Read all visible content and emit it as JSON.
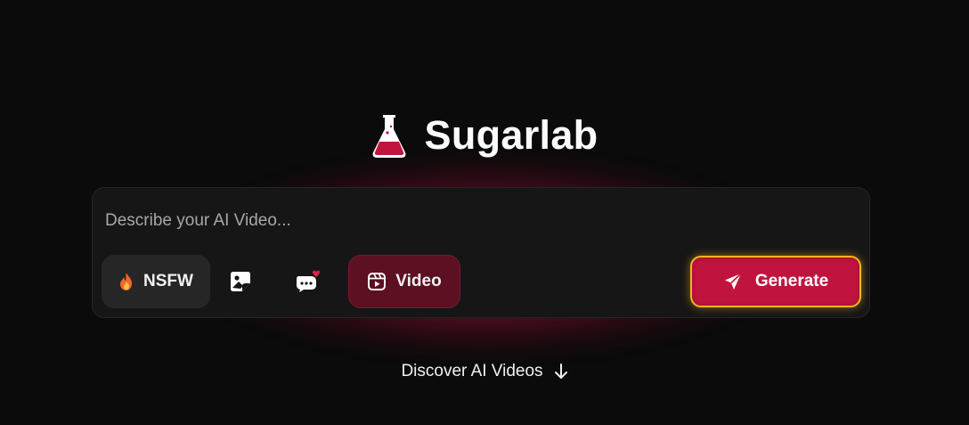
{
  "brand": {
    "title": "Sugarlab",
    "icon": "flask-icon",
    "flask_liquid_color": "#c0143e"
  },
  "prompt": {
    "placeholder": "Describe your AI Video...",
    "value": ""
  },
  "toolbar": {
    "nsfw_label": "NSFW",
    "nsfw_icon": "flame-icon",
    "image_icon": "image-sticker-icon",
    "chat_icon": "chat-heart-icon",
    "video_label": "Video",
    "video_icon": "video-icon",
    "generate_label": "Generate",
    "generate_icon": "send-icon"
  },
  "footer": {
    "discover_label": "Discover AI Videos",
    "discover_icon": "arrow-down-icon"
  },
  "colors": {
    "background": "#0b0b0b",
    "accent": "#c0143e",
    "generate_border": "#f2b51e",
    "video_pill": "#5c1021",
    "card": "#161616"
  }
}
